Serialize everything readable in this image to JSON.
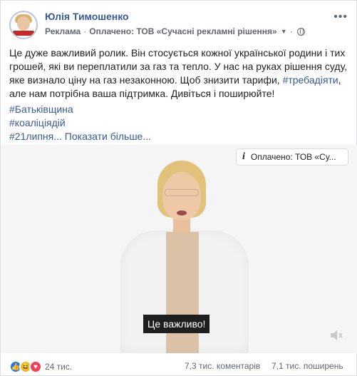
{
  "post": {
    "author": "Юлія Тимошенко",
    "ad_label": "Реклама",
    "separator": "·",
    "paid_by": "Оплачено: ТОВ «Сучасні рекламні рішення»",
    "more_icon": "ellipsis-icon",
    "body_part1": "Це дуже важливий ролик. Він стосується кожної української родини і тих грошей, які ви переплатили за газ та тепло. У нас на руках рішення суду, яке визнало ціну на газ незаконною. Щоб знизити тарифи, ",
    "body_hashtag": "#требадіяти",
    "body_part2": ", але нам потрібна ваша підтримка. Дивіться і поширюйте!",
    "hashtags": [
      "#Батьківщина",
      "#коаліціядій"
    ],
    "last_hashtag": "#21липня",
    "see_more": "... Показати більше..."
  },
  "video": {
    "sponsor_pill": "Оплачено: ТОВ «Су...",
    "caption": "Це важливо!",
    "mute_icon": "speaker-muted-icon"
  },
  "footer": {
    "reaction_count": "24 тис.",
    "comments": "7,3 тис. коментарів",
    "shares": "7,1 тис. поширень"
  },
  "colors": {
    "link": "#385898",
    "text": "#1c1e21",
    "secondary": "#606770"
  }
}
